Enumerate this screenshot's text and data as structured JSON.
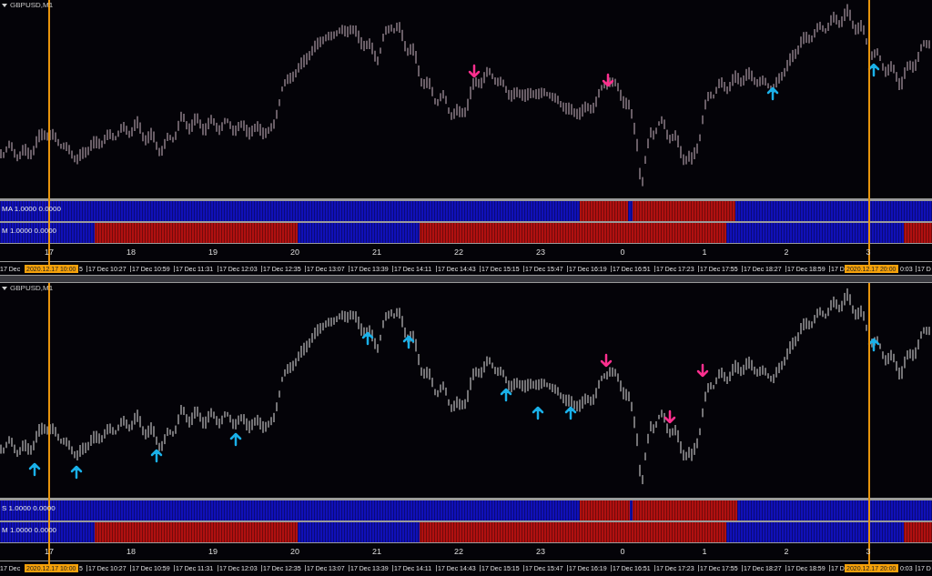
{
  "panels": [
    {
      "title": "GBPUSD,M1",
      "indicators": [
        {
          "label": "MA 1.0000 0.0000"
        },
        {
          "label": "M 1.0000 0.0000"
        }
      ],
      "days": [
        "17",
        "18",
        "19",
        "20",
        "21",
        "22",
        "23",
        "0",
        "1",
        "2",
        "3"
      ],
      "time_axis": {
        "left_fragment": "17 Dec",
        "left_tail": "5",
        "cursor_left": "2020.12.17 10:00",
        "labels": [
          "17 Dec 10:27",
          "17 Dec 10:59",
          "17 Dec 11:31",
          "17 Dec 12:03",
          "17 Dec 12:35",
          "17 Dec 13:07",
          "17 Dec 13:39",
          "17 Dec 14:11",
          "17 Dec 14:43",
          "17 Dec 15:15",
          "17 Dec 15:47",
          "17 Dec 16:19",
          "17 Dec 16:51",
          "17 Dec 17:23",
          "17 Dec 17:55",
          "17 Dec 18:27",
          "17 Dec 18:59"
        ],
        "right_fragment": "17 D",
        "cursor_right": "2020.12.17 20:00",
        "right_tail": "0:03",
        "edge": "17 D"
      }
    },
    {
      "title": "GBPUSD,M1",
      "indicators": [
        {
          "label": "S 1.0000 0.0000"
        },
        {
          "label": "M 1.0000 0.0000"
        }
      ],
      "days": [
        "17",
        "18",
        "19",
        "20",
        "21",
        "22",
        "23",
        "0",
        "1",
        "2",
        "3"
      ],
      "time_axis": {
        "left_fragment": "17 Dec",
        "left_tail": "5",
        "cursor_left": "2020.12.17 10:00",
        "labels": [
          "17 Dec 10:27",
          "17 Dec 10:59",
          "17 Dec 11:31",
          "17 Dec 12:03",
          "17 Dec 12:35",
          "17 Dec 13:07",
          "17 Dec 13:39",
          "17 Dec 14:11",
          "17 Dec 14:43",
          "17 Dec 15:15",
          "17 Dec 15:47",
          "17 Dec 16:19",
          "17 Dec 16:51",
          "17 Dec 17:23",
          "17 Dec 17:55",
          "17 Dec 18:27",
          "17 Dec 18:59"
        ],
        "right_fragment": "17 D",
        "cursor_right": "2020.12.17 20:00",
        "right_tail": "0:03",
        "edge": "17 D"
      }
    }
  ]
}
